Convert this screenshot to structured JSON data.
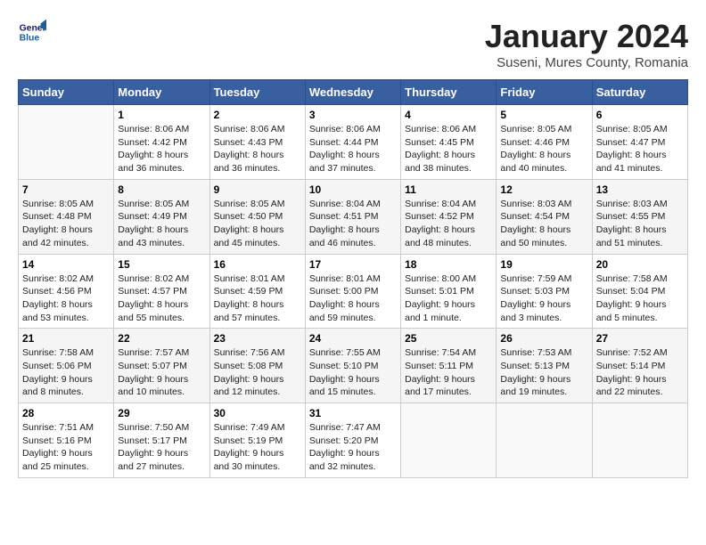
{
  "logo": {
    "line1": "General",
    "line2": "Blue"
  },
  "title": "January 2024",
  "subtitle": "Suseni, Mures County, Romania",
  "days_of_week": [
    "Sunday",
    "Monday",
    "Tuesday",
    "Wednesday",
    "Thursday",
    "Friday",
    "Saturday"
  ],
  "weeks": [
    [
      {
        "day": "",
        "info": ""
      },
      {
        "day": "1",
        "info": "Sunrise: 8:06 AM\nSunset: 4:42 PM\nDaylight: 8 hours\nand 36 minutes."
      },
      {
        "day": "2",
        "info": "Sunrise: 8:06 AM\nSunset: 4:43 PM\nDaylight: 8 hours\nand 36 minutes."
      },
      {
        "day": "3",
        "info": "Sunrise: 8:06 AM\nSunset: 4:44 PM\nDaylight: 8 hours\nand 37 minutes."
      },
      {
        "day": "4",
        "info": "Sunrise: 8:06 AM\nSunset: 4:45 PM\nDaylight: 8 hours\nand 38 minutes."
      },
      {
        "day": "5",
        "info": "Sunrise: 8:05 AM\nSunset: 4:46 PM\nDaylight: 8 hours\nand 40 minutes."
      },
      {
        "day": "6",
        "info": "Sunrise: 8:05 AM\nSunset: 4:47 PM\nDaylight: 8 hours\nand 41 minutes."
      }
    ],
    [
      {
        "day": "7",
        "info": "Sunrise: 8:05 AM\nSunset: 4:48 PM\nDaylight: 8 hours\nand 42 minutes."
      },
      {
        "day": "8",
        "info": "Sunrise: 8:05 AM\nSunset: 4:49 PM\nDaylight: 8 hours\nand 43 minutes."
      },
      {
        "day": "9",
        "info": "Sunrise: 8:05 AM\nSunset: 4:50 PM\nDaylight: 8 hours\nand 45 minutes."
      },
      {
        "day": "10",
        "info": "Sunrise: 8:04 AM\nSunset: 4:51 PM\nDaylight: 8 hours\nand 46 minutes."
      },
      {
        "day": "11",
        "info": "Sunrise: 8:04 AM\nSunset: 4:52 PM\nDaylight: 8 hours\nand 48 minutes."
      },
      {
        "day": "12",
        "info": "Sunrise: 8:03 AM\nSunset: 4:54 PM\nDaylight: 8 hours\nand 50 minutes."
      },
      {
        "day": "13",
        "info": "Sunrise: 8:03 AM\nSunset: 4:55 PM\nDaylight: 8 hours\nand 51 minutes."
      }
    ],
    [
      {
        "day": "14",
        "info": "Sunrise: 8:02 AM\nSunset: 4:56 PM\nDaylight: 8 hours\nand 53 minutes."
      },
      {
        "day": "15",
        "info": "Sunrise: 8:02 AM\nSunset: 4:57 PM\nDaylight: 8 hours\nand 55 minutes."
      },
      {
        "day": "16",
        "info": "Sunrise: 8:01 AM\nSunset: 4:59 PM\nDaylight: 8 hours\nand 57 minutes."
      },
      {
        "day": "17",
        "info": "Sunrise: 8:01 AM\nSunset: 5:00 PM\nDaylight: 8 hours\nand 59 minutes."
      },
      {
        "day": "18",
        "info": "Sunrise: 8:00 AM\nSunset: 5:01 PM\nDaylight: 9 hours\nand 1 minute."
      },
      {
        "day": "19",
        "info": "Sunrise: 7:59 AM\nSunset: 5:03 PM\nDaylight: 9 hours\nand 3 minutes."
      },
      {
        "day": "20",
        "info": "Sunrise: 7:58 AM\nSunset: 5:04 PM\nDaylight: 9 hours\nand 5 minutes."
      }
    ],
    [
      {
        "day": "21",
        "info": "Sunrise: 7:58 AM\nSunset: 5:06 PM\nDaylight: 9 hours\nand 8 minutes."
      },
      {
        "day": "22",
        "info": "Sunrise: 7:57 AM\nSunset: 5:07 PM\nDaylight: 9 hours\nand 10 minutes."
      },
      {
        "day": "23",
        "info": "Sunrise: 7:56 AM\nSunset: 5:08 PM\nDaylight: 9 hours\nand 12 minutes."
      },
      {
        "day": "24",
        "info": "Sunrise: 7:55 AM\nSunset: 5:10 PM\nDaylight: 9 hours\nand 15 minutes."
      },
      {
        "day": "25",
        "info": "Sunrise: 7:54 AM\nSunset: 5:11 PM\nDaylight: 9 hours\nand 17 minutes."
      },
      {
        "day": "26",
        "info": "Sunrise: 7:53 AM\nSunset: 5:13 PM\nDaylight: 9 hours\nand 19 minutes."
      },
      {
        "day": "27",
        "info": "Sunrise: 7:52 AM\nSunset: 5:14 PM\nDaylight: 9 hours\nand 22 minutes."
      }
    ],
    [
      {
        "day": "28",
        "info": "Sunrise: 7:51 AM\nSunset: 5:16 PM\nDaylight: 9 hours\nand 25 minutes."
      },
      {
        "day": "29",
        "info": "Sunrise: 7:50 AM\nSunset: 5:17 PM\nDaylight: 9 hours\nand 27 minutes."
      },
      {
        "day": "30",
        "info": "Sunrise: 7:49 AM\nSunset: 5:19 PM\nDaylight: 9 hours\nand 30 minutes."
      },
      {
        "day": "31",
        "info": "Sunrise: 7:47 AM\nSunset: 5:20 PM\nDaylight: 9 hours\nand 32 minutes."
      },
      {
        "day": "",
        "info": ""
      },
      {
        "day": "",
        "info": ""
      },
      {
        "day": "",
        "info": ""
      }
    ]
  ]
}
